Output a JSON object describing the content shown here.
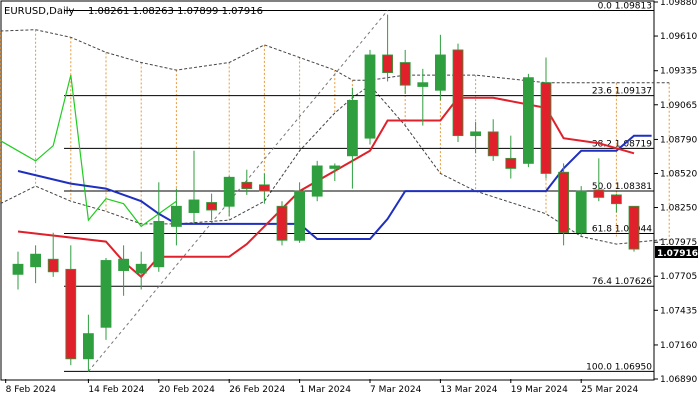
{
  "header": {
    "symbol": "EURUSD,Daily",
    "ohlc": "1.08261 1.08263 1.07899 1.07916"
  },
  "current_price": "1.07916",
  "colors": {
    "bull": "#2e9e3e",
    "bear": "#e0202a",
    "wick": "#2e9e3e",
    "tenkan": "#e0202a",
    "kijun": "#1f2fbf",
    "chikou": "#22cc22",
    "cloud": "#e79a3c",
    "cloud_edge": "#444444",
    "fib": "#000000",
    "price_badge": "#000000"
  },
  "chart_data": {
    "type": "candlestick",
    "title": "EURUSD,Daily",
    "ylim": [
      1.0689,
      1.0988
    ],
    "y_ticks": [
      "1.09880",
      "1.09610",
      "1.09335",
      "1.09065",
      "1.08790",
      "1.08520",
      "1.08250",
      "1.07975",
      "1.07705",
      "1.07435",
      "1.07160",
      "1.06890"
    ],
    "x_ticks": [
      "8 Feb 2024",
      "14 Feb 2024",
      "20 Feb 2024",
      "26 Feb 2024",
      "1 Mar 2024",
      "7 Mar 2024",
      "13 Mar 2024",
      "19 Mar 2024",
      "25 Mar 2024"
    ],
    "candles": [
      {
        "o": 1.0772,
        "h": 1.079,
        "l": 1.076,
        "c": 1.078
      },
      {
        "o": 1.0778,
        "h": 1.0795,
        "l": 1.0765,
        "c": 1.0788
      },
      {
        "o": 1.0784,
        "h": 1.0805,
        "l": 1.077,
        "c": 1.0774
      },
      {
        "o": 1.0776,
        "h": 1.0795,
        "l": 1.07,
        "c": 1.0705
      },
      {
        "o": 1.0705,
        "h": 1.074,
        "l": 1.0695,
        "c": 1.0725
      },
      {
        "o": 1.073,
        "h": 1.0785,
        "l": 1.072,
        "c": 1.0783
      },
      {
        "o": 1.0775,
        "h": 1.0795,
        "l": 1.0755,
        "c": 1.0784
      },
      {
        "o": 1.0773,
        "h": 1.079,
        "l": 1.076,
        "c": 1.078
      },
      {
        "o": 1.0778,
        "h": 1.0845,
        "l": 1.0774,
        "c": 1.0814
      },
      {
        "o": 1.081,
        "h": 1.084,
        "l": 1.0795,
        "c": 1.0826
      },
      {
        "o": 1.0821,
        "h": 1.087,
        "l": 1.0812,
        "c": 1.0831
      },
      {
        "o": 1.0829,
        "h": 1.0836,
        "l": 1.0815,
        "c": 1.0823
      },
      {
        "o": 1.0826,
        "h": 1.085,
        "l": 1.0818,
        "c": 1.0849
      },
      {
        "o": 1.0845,
        "h": 1.0855,
        "l": 1.0835,
        "c": 1.084
      },
      {
        "o": 1.0843,
        "h": 1.0852,
        "l": 1.0828,
        "c": 1.0838
      },
      {
        "o": 1.0826,
        "h": 1.083,
        "l": 1.0795,
        "c": 1.0799
      },
      {
        "o": 1.0799,
        "h": 1.0845,
        "l": 1.0797,
        "c": 1.0838
      },
      {
        "o": 1.0834,
        "h": 1.0862,
        "l": 1.083,
        "c": 1.0858
      },
      {
        "o": 1.0856,
        "h": 1.086,
        "l": 1.0846,
        "c": 1.0858
      },
      {
        "o": 1.0866,
        "h": 1.092,
        "l": 1.084,
        "c": 1.091
      },
      {
        "o": 1.088,
        "h": 1.095,
        "l": 1.0875,
        "c": 1.0946
      },
      {
        "o": 1.0946,
        "h": 1.0978,
        "l": 1.0925,
        "c": 1.0932
      },
      {
        "o": 1.094,
        "h": 1.095,
        "l": 1.0915,
        "c": 1.0922
      },
      {
        "o": 1.0921,
        "h": 1.0935,
        "l": 1.089,
        "c": 1.0924
      },
      {
        "o": 1.0918,
        "h": 1.0962,
        "l": 1.091,
        "c": 1.0946
      },
      {
        "o": 1.095,
        "h": 1.0955,
        "l": 1.0877,
        "c": 1.0882
      },
      {
        "o": 1.0882,
        "h": 1.0893,
        "l": 1.0868,
        "c": 1.0885
      },
      {
        "o": 1.0885,
        "h": 1.0895,
        "l": 1.0862,
        "c": 1.0866
      },
      {
        "o": 1.0864,
        "h": 1.0882,
        "l": 1.0848,
        "c": 1.0856
      },
      {
        "o": 1.086,
        "h": 1.0931,
        "l": 1.0857,
        "c": 1.0928
      },
      {
        "o": 1.0924,
        "h": 1.0944,
        "l": 1.0848,
        "c": 1.0852
      },
      {
        "o": 1.0853,
        "h": 1.086,
        "l": 1.0795,
        "c": 1.0805
      },
      {
        "o": 1.0805,
        "h": 1.0842,
        "l": 1.0802,
        "c": 1.0838
      },
      {
        "o": 1.0839,
        "h": 1.0864,
        "l": 1.083,
        "c": 1.0833
      },
      {
        "o": 1.0835,
        "h": 1.0836,
        "l": 1.0821,
        "c": 1.0828
      },
      {
        "o": 1.0826,
        "h": 1.0826,
        "l": 1.079,
        "c": 1.0792
      }
    ],
    "fib_levels": [
      {
        "label": "0.0 1.09813",
        "price": 1.09813
      },
      {
        "label": "23.6 1.09137",
        "price": 1.09137
      },
      {
        "label": "38.2 1.08719",
        "price": 1.08719
      },
      {
        "label": "50.0 1.08381",
        "price": 1.08381
      },
      {
        "label": "61.8 1.08044",
        "price": 1.08044
      },
      {
        "label": "76.4 1.07626",
        "price": 1.07626
      },
      {
        "label": "100.0 1.06950",
        "price": 1.0695
      }
    ],
    "tenkan": [
      [
        0,
        1.0806
      ],
      [
        5,
        1.0798
      ],
      [
        6,
        1.0782
      ],
      [
        7,
        1.077
      ],
      [
        8,
        1.0786
      ],
      [
        12,
        1.0786
      ],
      [
        13,
        1.0796
      ],
      [
        16,
        1.0838
      ],
      [
        20,
        1.087
      ],
      [
        21,
        1.0894
      ],
      [
        24,
        1.0894
      ],
      [
        25,
        1.0912
      ],
      [
        27,
        1.0912
      ],
      [
        30,
        1.0904
      ],
      [
        31,
        1.088
      ],
      [
        33,
        1.0876
      ],
      [
        35,
        1.0868
      ]
    ],
    "kijun": [
      [
        0,
        1.0854
      ],
      [
        3,
        1.0844
      ],
      [
        5,
        1.084
      ],
      [
        7,
        1.083
      ],
      [
        8,
        1.082
      ],
      [
        9,
        1.0812
      ],
      [
        16,
        1.0812
      ],
      [
        17,
        1.08
      ],
      [
        20,
        1.08
      ],
      [
        21,
        1.0816
      ],
      [
        22,
        1.0838
      ],
      [
        30,
        1.0838
      ],
      [
        31,
        1.0856
      ],
      [
        32,
        1.087
      ],
      [
        34,
        1.087
      ],
      [
        35,
        1.0882
      ],
      [
        36,
        1.0882
      ]
    ],
    "chikou": [
      [
        -1,
        1.0878
      ],
      [
        0,
        1.087
      ],
      [
        1,
        1.0862
      ],
      [
        2,
        1.0874
      ],
      [
        3,
        1.093
      ],
      [
        4,
        1.0815
      ],
      [
        5,
        1.0832
      ],
      [
        6,
        1.0828
      ],
      [
        7,
        1.081
      ],
      [
        8,
        1.082
      ],
      [
        9,
        1.083
      ]
    ],
    "cloud_top": [
      [
        -1,
        1.0965
      ],
      [
        1,
        1.0966
      ],
      [
        3,
        1.096
      ],
      [
        5,
        1.0948
      ],
      [
        7,
        1.094
      ],
      [
        9,
        1.0934
      ],
      [
        12,
        1.094
      ],
      [
        14,
        1.0954
      ],
      [
        16,
        1.0944
      ],
      [
        18,
        1.0934
      ],
      [
        19,
        1.0926
      ],
      [
        20,
        1.0926
      ],
      [
        22,
        1.093
      ],
      [
        24,
        1.093
      ],
      [
        26,
        1.093
      ],
      [
        30,
        1.0924
      ],
      [
        34,
        1.0924
      ],
      [
        37,
        1.0924
      ]
    ],
    "cloud_bottom": [
      [
        -1,
        1.0828
      ],
      [
        1,
        1.0842
      ],
      [
        3,
        1.083
      ],
      [
        5,
        1.0822
      ],
      [
        7,
        1.0812
      ],
      [
        9,
        1.0812
      ],
      [
        12,
        1.0815
      ],
      [
        14,
        1.083
      ],
      [
        16,
        1.087
      ],
      [
        18,
        1.09
      ],
      [
        19,
        1.0912
      ],
      [
        20,
        1.0922
      ],
      [
        22,
        1.089
      ],
      [
        24,
        1.0852
      ],
      [
        26,
        1.0838
      ],
      [
        30,
        1.082
      ],
      [
        32,
        1.0802
      ],
      [
        34,
        1.0796
      ],
      [
        37,
        1.08
      ]
    ],
    "fib_trendline": [
      [
        4,
        1.0695
      ],
      [
        21,
        1.09813
      ]
    ]
  }
}
